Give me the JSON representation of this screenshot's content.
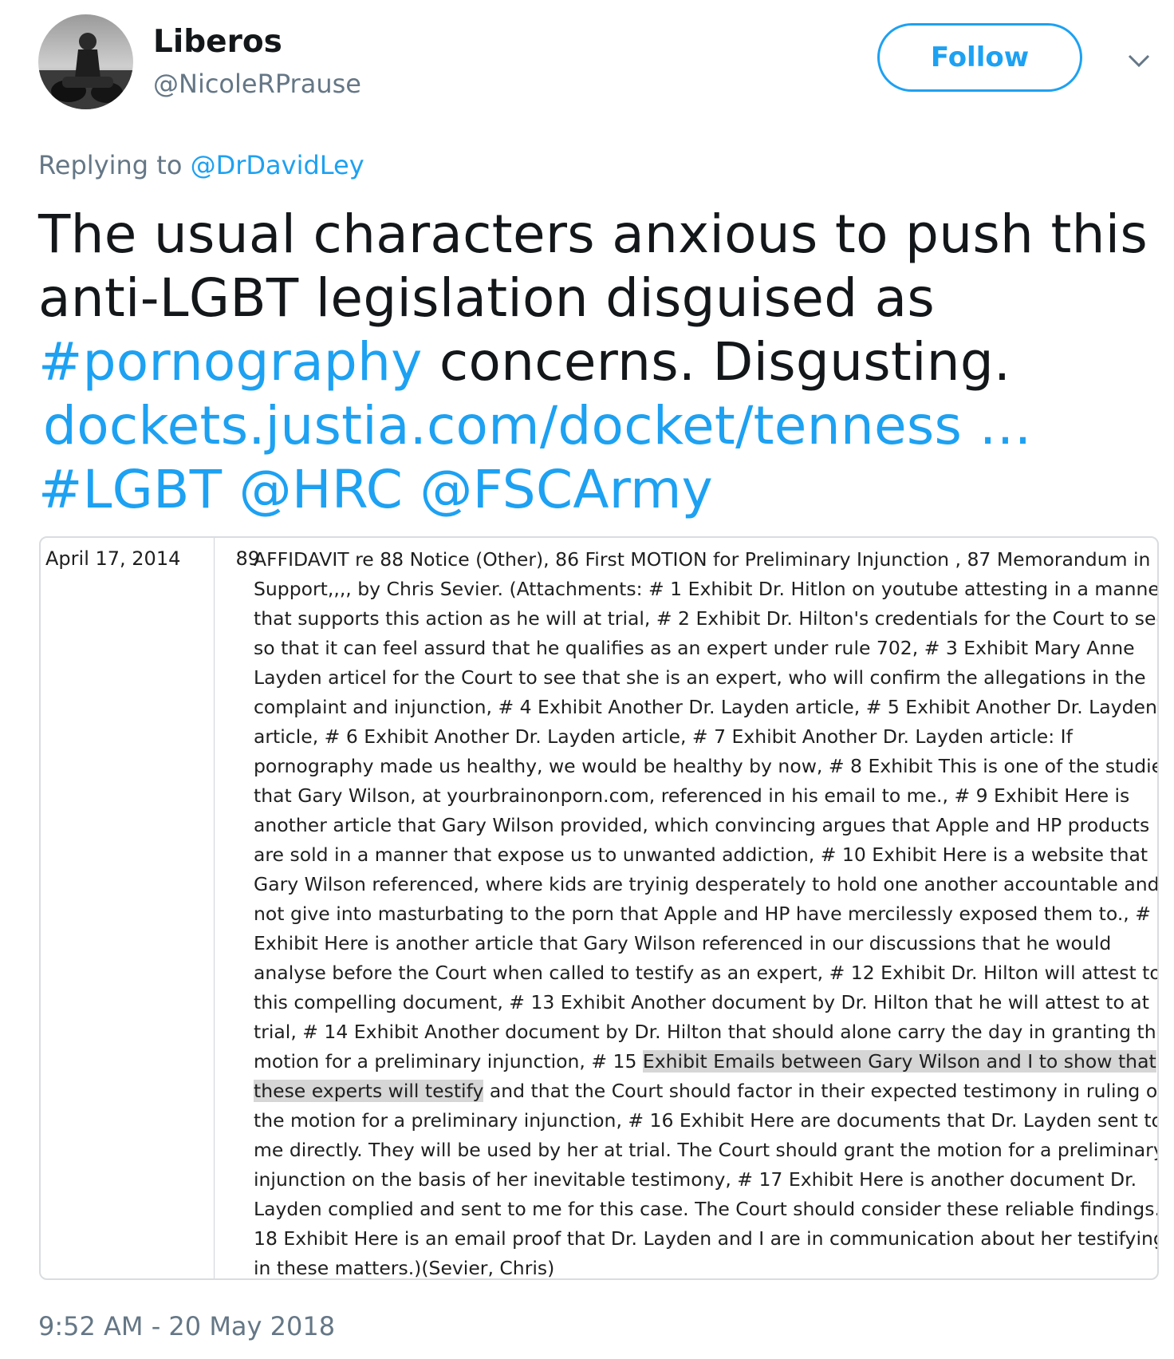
{
  "author": {
    "display_name": "Liberos",
    "handle": "@NicoleRPrause"
  },
  "follow_label": "Follow",
  "reply": {
    "prefix": "Replying to",
    "to": "@DrDavidLey"
  },
  "tweet": {
    "line1": "The usual characters anxious to push this",
    "line2": "anti-LGBT legislation disguised as",
    "hashtag_pornography": "#pornography",
    "line3_rest": " concerns. Disgusting.",
    "link": "dockets.justia.com/docket/tenness …",
    "hashtag_lgbt": "#LGBT",
    "mention_hrc": "@HRC",
    "mention_fsc": "@FSCArmy"
  },
  "docket": {
    "date": "April 17, 2014",
    "number": "89",
    "lines": [
      "AFFIDAVIT re 88 Notice (Other), 86 First MOTION for Preliminary Injunction , 87 Memorandum in",
      "Support,,,, by Chris Sevier. (Attachments: # 1 Exhibit Dr. Hitlon on youtube attesting in a manner",
      "that supports this action as he will at trial, # 2 Exhibit Dr. Hilton's credentials for the Court to see",
      "so that it can feel assurd that he qualifies as an expert under rule 702, # 3 Exhibit Mary Anne",
      "Layden articel for the Court to see that she is an expert, who will confirm the allegations in the",
      "complaint and injunction, # 4 Exhibit Another Dr. Layden article, # 5 Exhibit Another Dr. Layden",
      "article, # 6 Exhibit Another Dr. Layden article, # 7 Exhibit Another Dr. Layden article: If",
      "pornography made us healthy, we would be healthy by now, # 8 Exhibit This is one of the studies",
      "that Gary Wilson, at yourbrainonporn.com, referenced in his email to me., # 9 Exhibit Here is",
      "another article that Gary Wilson provided, which convincing argues that Apple and HP products",
      "are sold in a manner that expose us to unwanted addiction, # 10 Exhibit Here is a website that",
      "Gary Wilson referenced, where kids are tryinig desperately to hold one another accountable and",
      "not give into masturbating to the porn that Apple and HP have mercilessly exposed them to., # 11",
      "Exhibit Here is another article that Gary Wilson referenced in our discussions that he would",
      "analyse before the Court when called to testify as an expert, # 12 Exhibit Dr. Hilton will attest to",
      "this compelling document, # 13 Exhibit Another document by Dr. Hilton that he will attest to at",
      "trial, # 14 Exhibit Another document by Dr. Hilton that should alone carry the day in granting the"
    ],
    "line18_pre": "motion for a preliminary injunction, # 15 ",
    "line18_hl": "Exhibit Emails between Gary Wilson and I to show that",
    "line19_hl": "these experts will testify",
    "line19_post": " and that the Court should factor in their expected testimony in ruling on",
    "lines_after": [
      "the motion for a preliminary injunction, # 16 Exhibit Here are documents that Dr. Layden sent to",
      "me directly. They will be used by her at trial. The Court should grant the motion for a preliminary",
      "injunction on the basis of her inevitable testimony, # 17 Exhibit Here is another document Dr.",
      "Layden complied and sent to me for this case. The Court should consider these reliable findings., #",
      "18 Exhibit Here is an email proof that Dr. Layden and I are in communication about her testifying",
      "in these matters.)(Sevier, Chris)"
    ]
  },
  "timestamp": "9:52 AM - 20 May 2018"
}
